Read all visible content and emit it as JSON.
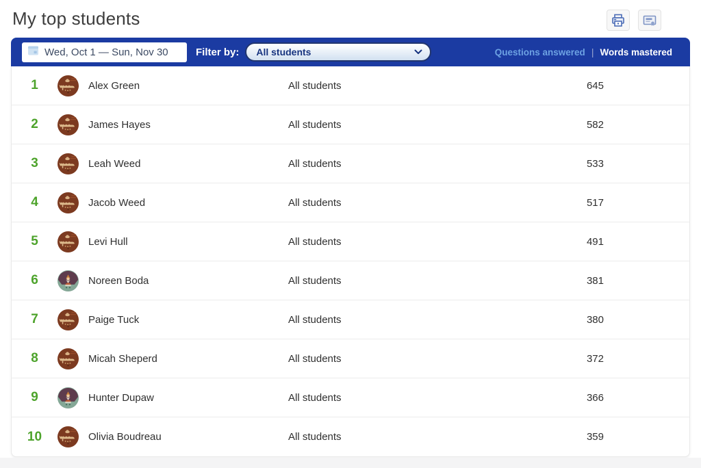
{
  "page": {
    "title": "My top students"
  },
  "header": {
    "buttons": [
      {
        "icon": "printer-icon"
      },
      {
        "icon": "certificate-icon"
      }
    ]
  },
  "filter_bar": {
    "date_range": "Wed, Oct 1 — Sun, Nov 30",
    "filter_label": "Filter by:",
    "filter_value": "All students",
    "tabs": [
      {
        "label": "Questions answered",
        "active": false
      },
      {
        "label": "Words mastered",
        "active": true
      }
    ],
    "separator": "|"
  },
  "colors": {
    "bar_blue": "#1b3ba2",
    "rank_green": "#4da32b",
    "inactive_tab_blue": "#6da2e3"
  },
  "leaderboard": {
    "rows": [
      {
        "rank": "1",
        "name": "Alex Green",
        "group": "All students",
        "value": "645",
        "avatar": "croc"
      },
      {
        "rank": "2",
        "name": "James Hayes",
        "group": "All students",
        "value": "582",
        "avatar": "croc"
      },
      {
        "rank": "3",
        "name": "Leah Weed",
        "group": "All students",
        "value": "533",
        "avatar": "croc"
      },
      {
        "rank": "4",
        "name": "Jacob Weed",
        "group": "All students",
        "value": "517",
        "avatar": "croc"
      },
      {
        "rank": "5",
        "name": "Levi Hull",
        "group": "All students",
        "value": "491",
        "avatar": "croc"
      },
      {
        "rank": "6",
        "name": "Noreen Boda",
        "group": "All students",
        "value": "381",
        "avatar": "gnome"
      },
      {
        "rank": "7",
        "name": "Paige Tuck",
        "group": "All students",
        "value": "380",
        "avatar": "croc"
      },
      {
        "rank": "8",
        "name": "Micah Sheperd",
        "group": "All students",
        "value": "372",
        "avatar": "croc"
      },
      {
        "rank": "9",
        "name": "Hunter Dupaw",
        "group": "All students",
        "value": "366",
        "avatar": "gnome"
      },
      {
        "rank": "10",
        "name": "Olivia Boudreau",
        "group": "All students",
        "value": "359",
        "avatar": "croc"
      }
    ]
  }
}
